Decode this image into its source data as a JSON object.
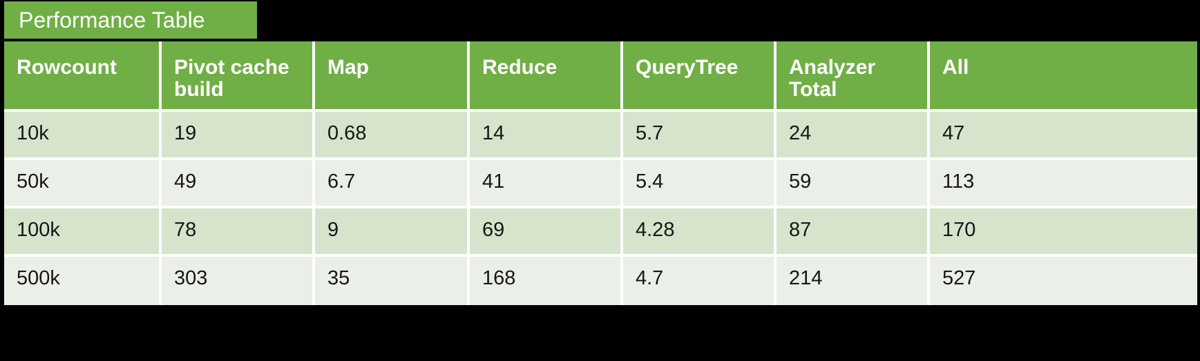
{
  "title": {
    "label": "Performance Table"
  },
  "colors": {
    "header_green": "#70AF46",
    "row_band_dark": "#D5E4CB",
    "row_band_light": "#EAEFE8",
    "background": "#000000",
    "header_text": "#FFFFFF",
    "cell_text": "#161616"
  },
  "table": {
    "columns": [
      "Rowcount",
      "Pivot cache build",
      "Map",
      "Reduce",
      "QueryTree",
      "Analyzer Total",
      "All"
    ],
    "rows": [
      {
        "band": "dark",
        "cells": [
          "10k",
          "19",
          "0.68",
          "14",
          "5.7",
          "24",
          "47"
        ]
      },
      {
        "band": "light",
        "cells": [
          "50k",
          "49",
          "6.7",
          "41",
          "5.4",
          "59",
          "113"
        ]
      },
      {
        "band": "dark",
        "cells": [
          "100k",
          "78",
          "9",
          "69",
          "4.28",
          "87",
          "170"
        ]
      },
      {
        "band": "light",
        "cells": [
          "500k",
          "303",
          "35",
          "168",
          "4.7",
          "214",
          "527"
        ]
      }
    ]
  },
  "chart_data": {
    "type": "table",
    "title": "Performance Table",
    "columns": [
      "Rowcount",
      "Pivot cache build",
      "Map",
      "Reduce",
      "QueryTree",
      "Analyzer Total",
      "All"
    ],
    "categories": [
      "10k",
      "50k",
      "100k",
      "500k"
    ],
    "series": [
      {
        "name": "Pivot cache build",
        "values": [
          19,
          49,
          78,
          303
        ]
      },
      {
        "name": "Map",
        "values": [
          0.68,
          6.7,
          9,
          35
        ]
      },
      {
        "name": "Reduce",
        "values": [
          14,
          41,
          69,
          168
        ]
      },
      {
        "name": "QueryTree",
        "values": [
          5.7,
          5.4,
          4.28,
          4.7
        ]
      },
      {
        "name": "Analyzer Total",
        "values": [
          24,
          59,
          87,
          214
        ]
      },
      {
        "name": "All",
        "values": [
          47,
          113,
          170,
          527
        ]
      }
    ],
    "xlabel": "Rowcount",
    "ylabel": "",
    "grid": true,
    "legend": "none"
  }
}
